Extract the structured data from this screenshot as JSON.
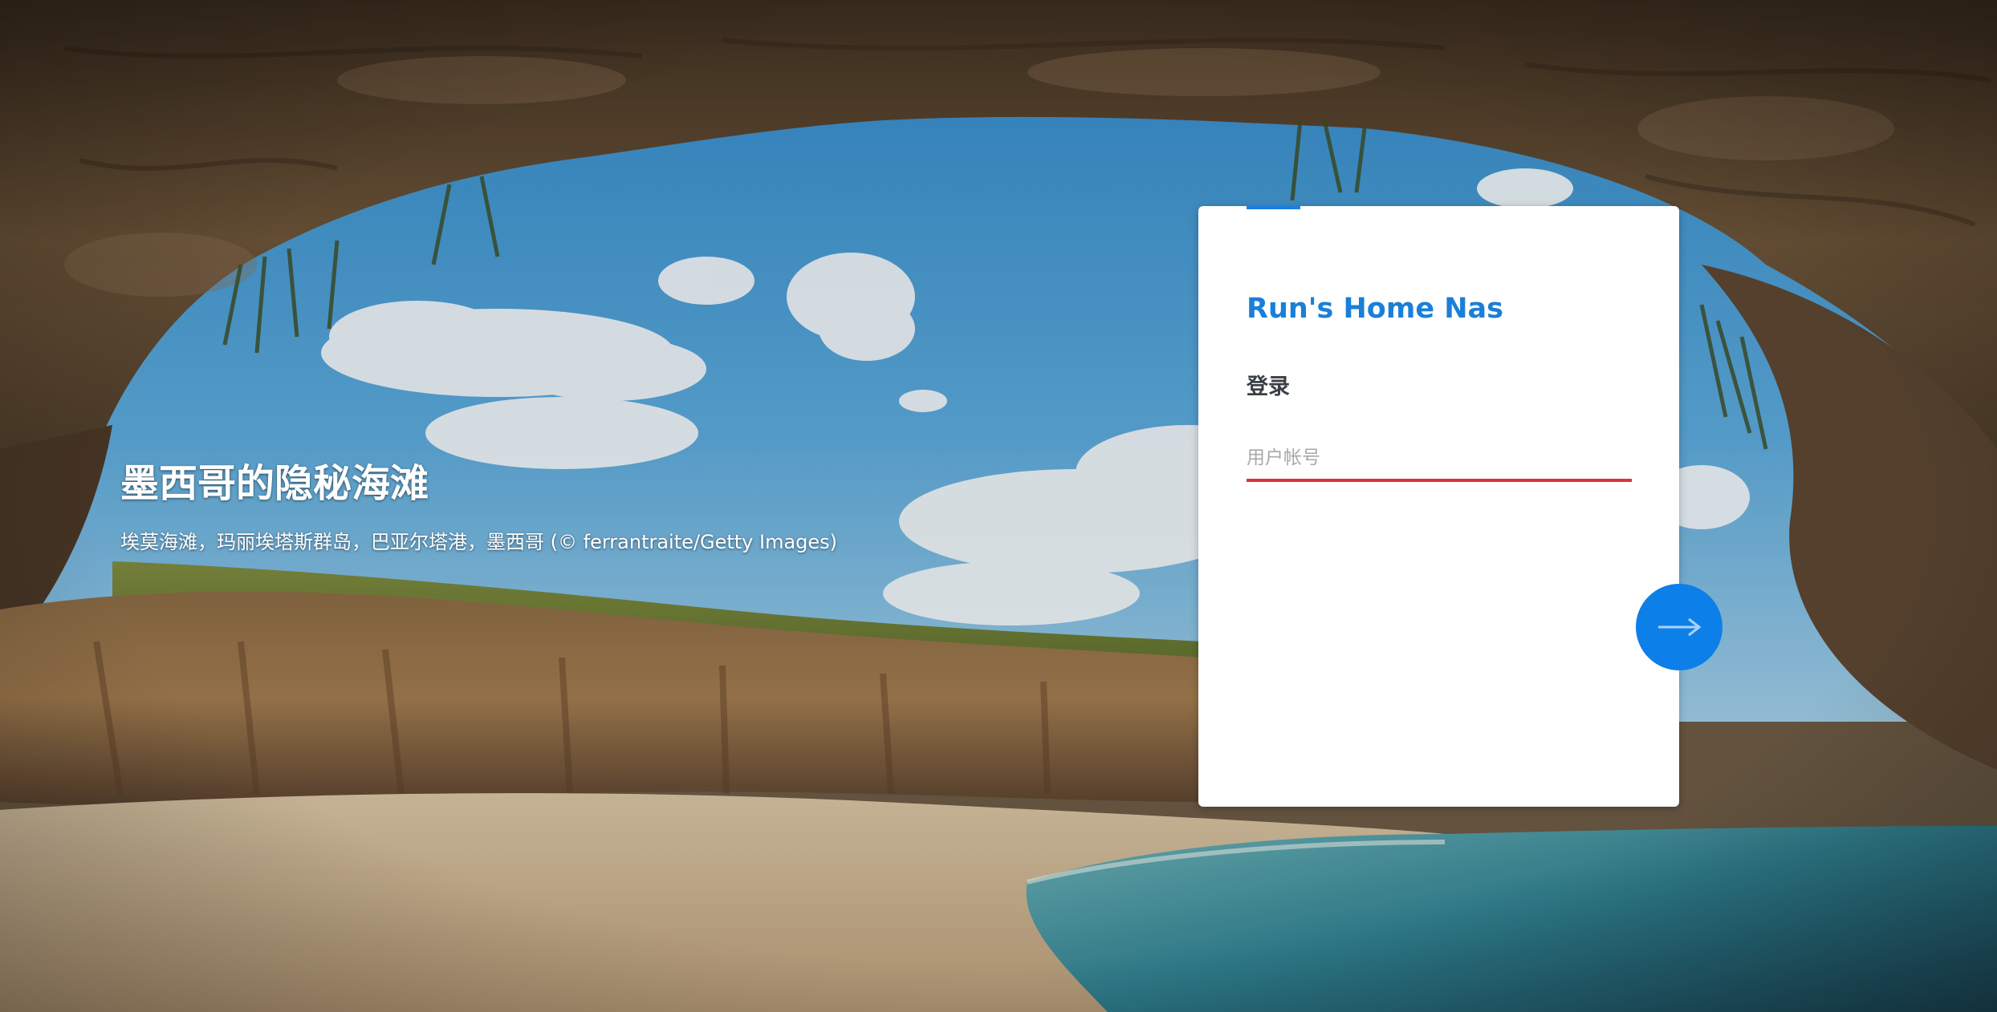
{
  "background": {
    "title": "墨西哥的隐秘海滩",
    "caption": "埃莫海滩，玛丽埃塔斯群岛，巴亚尔塔港，墨西哥 (© ferrantraite/Getty Images)"
  },
  "login": {
    "brand": "Run's Home Nas",
    "heading": "登录",
    "username_placeholder": "用户帐号",
    "username_value": "",
    "progress": 0.14,
    "accent_color": "#1a7fd8",
    "error_underline_color": "#d7363c",
    "next_button_icon": "arrow-right-icon"
  }
}
